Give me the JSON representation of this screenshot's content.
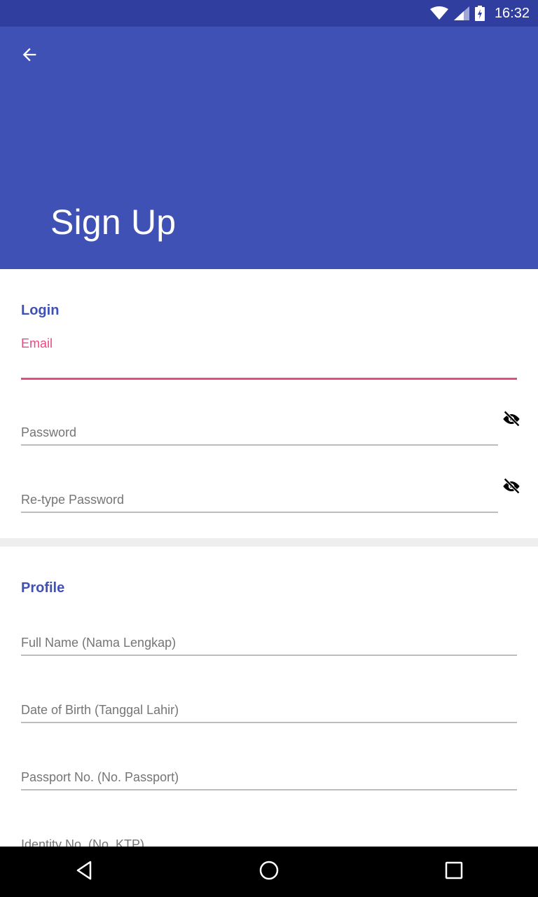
{
  "status_bar": {
    "time": "16:32",
    "icons": [
      "wifi-icon",
      "signal-icon",
      "battery-charging-icon"
    ]
  },
  "app_bar": {
    "back_icon": "arrow-back-icon",
    "title": "Sign Up",
    "color": "#3f51b5"
  },
  "login": {
    "section_title": "Login",
    "email_label": "Email",
    "email_value": "",
    "password_placeholder": "Password",
    "retype_password_placeholder": "Re-type Password",
    "visibility_icon": "eye-off-icon"
  },
  "profile": {
    "section_title": "Profile",
    "full_name_placeholder": "Full Name (Nama Lengkap)",
    "dob_placeholder": "Date of Birth (Tanggal Lahir)",
    "passport_placeholder": "Passport No. (No. Passport)",
    "identity_placeholder": "Identity No. (No. KTP)"
  },
  "nav_bar": {
    "icons": [
      "back-triangle-icon",
      "home-circle-icon",
      "recents-square-icon"
    ]
  },
  "colors": {
    "primary": "#3f51b5",
    "primary_dark": "#303f9f",
    "accent": "#e84a83"
  }
}
